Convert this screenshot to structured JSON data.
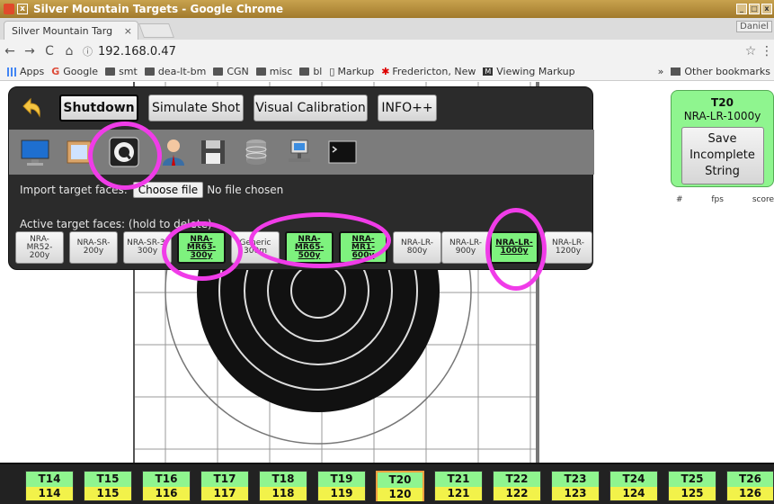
{
  "window": {
    "title": "Silver Mountain Targets - Google Chrome",
    "close_glyph": "x",
    "min_glyph": "_",
    "max_glyph": "□",
    "winclose_glyph": "x"
  },
  "tabs": {
    "active_title": "Silver Mountain Targ",
    "close_glyph": "×",
    "profile_name": "Daniel"
  },
  "addressbar": {
    "back": "←",
    "forward": "→",
    "reload": "C",
    "home": "⌂",
    "info": "ⓘ",
    "url": "192.168.0.47",
    "star": "☆",
    "menu": "⋮"
  },
  "bookmarks": {
    "items": [
      "Apps",
      "Google",
      "smt",
      "dea-lt-bm",
      "CGN",
      "misc",
      "bl",
      "Markup",
      "Fredericton, New",
      "Viewing Markup"
    ],
    "overflow": "»",
    "other": "Other bookmarks"
  },
  "panel": {
    "back_icon": "back-arrow-icon",
    "buttons": {
      "shutdown": "Shutdown",
      "simulate": "Simulate Shot",
      "calibration": "Visual Calibration",
      "info": "INFO++"
    },
    "icons": [
      "monitor-icon",
      "picture-icon",
      "wrench-settings-icon",
      "user-icon",
      "save-disk-icon",
      "database-icon",
      "network-icon",
      "terminal-icon"
    ],
    "import_label": "Import target faces:",
    "choose_file": "Choose file",
    "no_file": "No file chosen",
    "active_label": "Active target faces: (hold to delete)",
    "faces": [
      {
        "label": "NRA-MR52-200y",
        "active": false
      },
      {
        "label": "NRA-SR-200y",
        "active": false
      },
      {
        "label": "NRA-SR-3-300y",
        "active": false
      },
      {
        "label": "NRA-MR63-300y",
        "active": true
      },
      {
        "label": "Generic 300m",
        "active": false
      },
      {
        "label": "NRA-MR65-500y",
        "active": true
      },
      {
        "label": "NRA-MR1-600y",
        "active": true
      },
      {
        "label": "NRA-LR-800y",
        "active": false
      },
      {
        "label": "NRA-LR-900y",
        "active": false
      },
      {
        "label": "NRA-LR-1000y",
        "active": true
      },
      {
        "label": "NRA-LR-1200y",
        "active": false
      }
    ]
  },
  "sidebar": {
    "target": "T20",
    "face": "NRA-LR-1000y",
    "save_button": "Save Incomplete String",
    "col_num": "#",
    "col_fps": "fps",
    "col_score": "score"
  },
  "shots": [
    {
      "target": "T14",
      "num": "114",
      "selected": false
    },
    {
      "target": "T15",
      "num": "115",
      "selected": false
    },
    {
      "target": "T16",
      "num": "116",
      "selected": false
    },
    {
      "target": "T17",
      "num": "117",
      "selected": false
    },
    {
      "target": "T18",
      "num": "118",
      "selected": false
    },
    {
      "target": "T19",
      "num": "119",
      "selected": false
    },
    {
      "target": "T20",
      "num": "120",
      "selected": true
    },
    {
      "target": "T21",
      "num": "121",
      "selected": false
    },
    {
      "target": "T22",
      "num": "122",
      "selected": false
    },
    {
      "target": "T23",
      "num": "123",
      "selected": false
    },
    {
      "target": "T24",
      "num": "124",
      "selected": false
    },
    {
      "target": "T25",
      "num": "125",
      "selected": false
    },
    {
      "target": "T26",
      "num": "126",
      "selected": false
    }
  ],
  "colors": {
    "highlight": "#f03ce8",
    "active_face": "#7ef27e",
    "shot_top": "#8ff58f",
    "shot_bottom": "#f2f24a",
    "selected_shot_border": "#f0a040"
  }
}
